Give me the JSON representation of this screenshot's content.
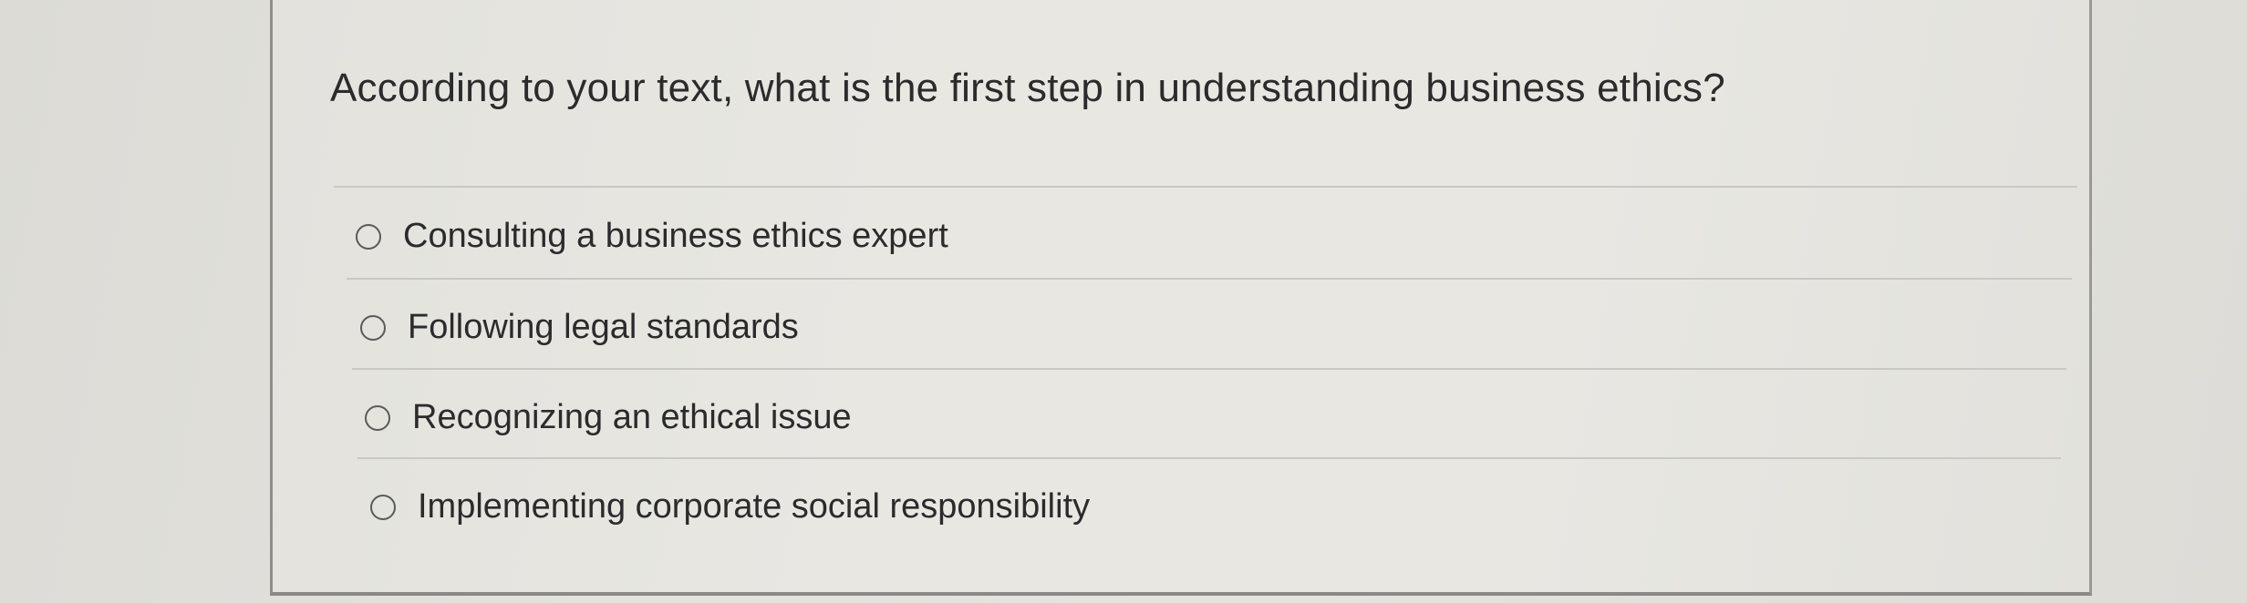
{
  "question": {
    "text": "According to your text, what is the first step in understanding business ethics?"
  },
  "options": [
    {
      "label": "Consulting a business ethics expert",
      "selected": false
    },
    {
      "label": "Following legal standards",
      "selected": false
    },
    {
      "label": "Recognizing an ethical issue",
      "selected": false
    },
    {
      "label": "Implementing corporate social responsibility",
      "selected": false
    }
  ],
  "icons": {
    "option_marker": "radio-circle"
  },
  "colors": {
    "text": "#2b2b2b",
    "panel_border": "#8f8e89",
    "divider": "#c9c8c3"
  }
}
